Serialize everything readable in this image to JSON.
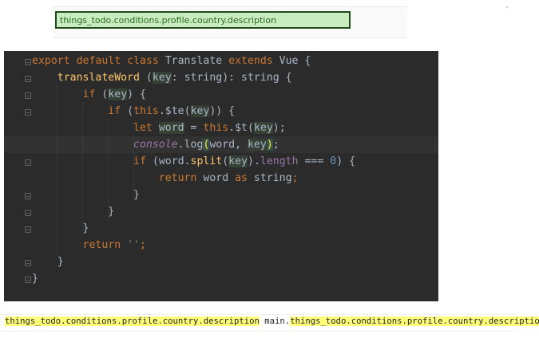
{
  "tooltip": {
    "text": "things_todo.conditions.profile.country.description"
  },
  "editor": {
    "lines": [
      {
        "segments": [
          {
            "t": "export default class ",
            "c": "kw"
          },
          {
            "t": "Translate ",
            "c": ""
          },
          {
            "t": "extends ",
            "c": "kw"
          },
          {
            "t": "Vue {",
            "c": ""
          }
        ]
      },
      {
        "segments": [
          {
            "t": "    ",
            "c": ""
          },
          {
            "t": "translateWord",
            "c": "fn"
          },
          {
            "t": " (",
            "c": ""
          },
          {
            "t": "key",
            "c": "hl"
          },
          {
            "t": ": string): string {",
            "c": ""
          }
        ]
      },
      {
        "segments": [
          {
            "t": "        ",
            "c": ""
          },
          {
            "t": "if",
            "c": "kw"
          },
          {
            "t": " (",
            "c": ""
          },
          {
            "t": "key",
            "c": "hl"
          },
          {
            "t": ") {",
            "c": ""
          }
        ]
      },
      {
        "segments": [
          {
            "t": "            ",
            "c": ""
          },
          {
            "t": "if",
            "c": "kw"
          },
          {
            "t": " (",
            "c": ""
          },
          {
            "t": "this",
            "c": "kw"
          },
          {
            "t": ".$te(",
            "c": ""
          },
          {
            "t": "key",
            "c": "hl"
          },
          {
            "t": ")) {",
            "c": ""
          }
        ]
      },
      {
        "segments": [
          {
            "t": "                ",
            "c": ""
          },
          {
            "t": "let ",
            "c": "kw"
          },
          {
            "t": "word",
            "c": "hl"
          },
          {
            "t": " = ",
            "c": ""
          },
          {
            "t": "this",
            "c": "kw"
          },
          {
            "t": ".$t(",
            "c": ""
          },
          {
            "t": "key",
            "c": "hl"
          },
          {
            "t": ");",
            "c": ""
          }
        ]
      },
      {
        "current": true,
        "segments": [
          {
            "t": "                ",
            "c": ""
          },
          {
            "t": "console",
            "c": "ital"
          },
          {
            "t": ".log",
            "c": ""
          },
          {
            "t": "(",
            "c": "match"
          },
          {
            "t": "word, ",
            "c": ""
          },
          {
            "t": "key",
            "c": "hl"
          },
          {
            "t": ")",
            "c": "match"
          },
          {
            "t": ";",
            "c": ""
          }
        ]
      },
      {
        "segments": [
          {
            "t": "                ",
            "c": ""
          },
          {
            "t": "if",
            "c": "kw"
          },
          {
            "t": " (word.",
            "c": ""
          },
          {
            "t": "split",
            "c": "fn"
          },
          {
            "t": "(",
            "c": ""
          },
          {
            "t": "key",
            "c": "hl"
          },
          {
            "t": ").",
            "c": ""
          },
          {
            "t": "length",
            "c": "purple"
          },
          {
            "t": " === ",
            "c": ""
          },
          {
            "t": "0",
            "c": "num"
          },
          {
            "t": ") {",
            "c": ""
          }
        ]
      },
      {
        "segments": [
          {
            "t": "                    ",
            "c": ""
          },
          {
            "t": "return ",
            "c": "kw"
          },
          {
            "t": "word ",
            "c": ""
          },
          {
            "t": "as ",
            "c": "kw"
          },
          {
            "t": "string",
            "c": ""
          },
          {
            "t": ";",
            "c": "kw"
          }
        ]
      },
      {
        "segments": [
          {
            "t": "                }",
            "c": ""
          }
        ]
      },
      {
        "segments": [
          {
            "t": "            }",
            "c": ""
          }
        ]
      },
      {
        "segments": [
          {
            "t": "        }",
            "c": ""
          }
        ]
      },
      {
        "segments": [
          {
            "t": "        ",
            "c": ""
          },
          {
            "t": "return ",
            "c": "kw"
          },
          {
            "t": "''",
            "c": "str"
          },
          {
            "t": ";",
            "c": "kw"
          }
        ]
      },
      {
        "segments": [
          {
            "t": "    }",
            "c": ""
          }
        ]
      },
      {
        "segments": [
          {
            "t": "}",
            "c": ""
          }
        ]
      }
    ]
  },
  "output": {
    "first": "things_todo.conditions.profile.country.description",
    "prefix": "main.",
    "second": "things_todo.conditions.profile.country.description"
  }
}
